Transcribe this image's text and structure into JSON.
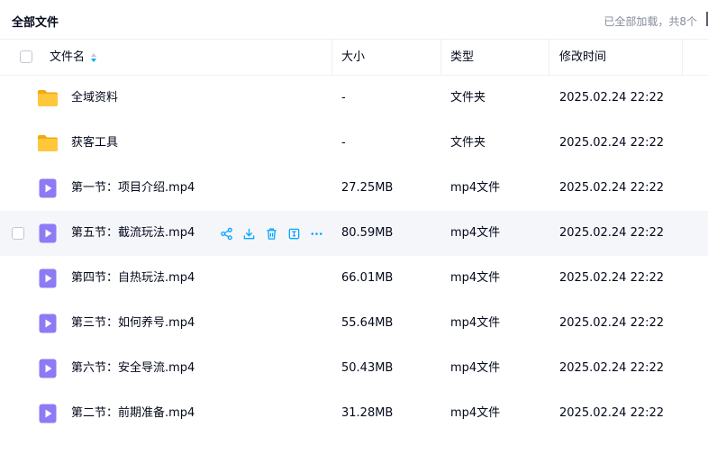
{
  "header": {
    "breadcrumb": "全部文件",
    "loaded_status": "已全部加载，共8个"
  },
  "columns": {
    "name": "文件名",
    "size": "大小",
    "type": "类型",
    "modified": "修改时间"
  },
  "files": [
    {
      "name": "全域资料",
      "size": "-",
      "type": "文件夹",
      "modified": "2025.02.24 22:22",
      "icon": "folder-icon"
    },
    {
      "name": "获客工具",
      "size": "-",
      "type": "文件夹",
      "modified": "2025.02.24 22:22",
      "icon": "folder-icon"
    },
    {
      "name": "第一节：项目介绍.mp4",
      "size": "27.25MB",
      "type": "mp4文件",
      "modified": "2025.02.24 22:22",
      "icon": "video-file-icon"
    },
    {
      "name": "第五节：截流玩法.mp4",
      "size": "80.59MB",
      "type": "mp4文件",
      "modified": "2025.02.24 22:22",
      "icon": "video-file-icon",
      "hovered": true
    },
    {
      "name": "第四节：自热玩法.mp4",
      "size": "66.01MB",
      "type": "mp4文件",
      "modified": "2025.02.24 22:22",
      "icon": "video-file-icon"
    },
    {
      "name": "第三节：如何养号.mp4",
      "size": "55.64MB",
      "type": "mp4文件",
      "modified": "2025.02.24 22:22",
      "icon": "video-file-icon"
    },
    {
      "name": "第六节：安全导流.mp4",
      "size": "50.43MB",
      "type": "mp4文件",
      "modified": "2025.02.24 22:22",
      "icon": "video-file-icon"
    },
    {
      "name": "第二节：前期准备.mp4",
      "size": "31.28MB",
      "type": "mp4文件",
      "modified": "2025.02.24 22:22",
      "icon": "video-file-icon"
    }
  ],
  "row_actions": [
    "share-icon",
    "download-icon",
    "delete-icon",
    "rename-icon",
    "more-icon"
  ],
  "colors": {
    "accent": "#06a7ff",
    "folder": "#ffc73b",
    "video": "#8c7bf5",
    "hover_row": "#f5f6fa"
  }
}
